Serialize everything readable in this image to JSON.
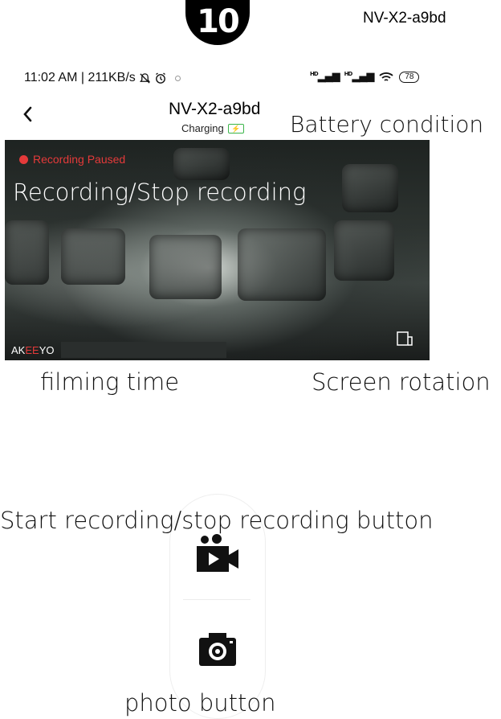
{
  "step": {
    "number": "10"
  },
  "device_label_top": "NV-X2-a9bd",
  "status_bar": {
    "time_speed": "11:02 AM | 211KB/s",
    "mute_icon": "bell-off-icon",
    "alarm_icon": "alarm-icon",
    "signal1": "HD",
    "signal2": "HD",
    "battery": "78"
  },
  "nav": {
    "back_icon": "chevron-left-icon",
    "title": "NV-X2-a9bd",
    "subtitle": "Charging"
  },
  "video": {
    "status": "Recording Paused",
    "watermark_pre": "AK",
    "watermark_mid": "EE",
    "watermark_post": "YO"
  },
  "annotations": {
    "battery_condition": "Battery condition",
    "recording_stop": "Recording/Stop recording",
    "filming_time": "filming time",
    "screen_rotation": "Screen rotation",
    "start_stop_button": "Start recording/stop recording button",
    "photo_button": "photo button"
  },
  "colors": {
    "accent_red": "#e43a3a",
    "charging_green": "#3bb54a"
  }
}
